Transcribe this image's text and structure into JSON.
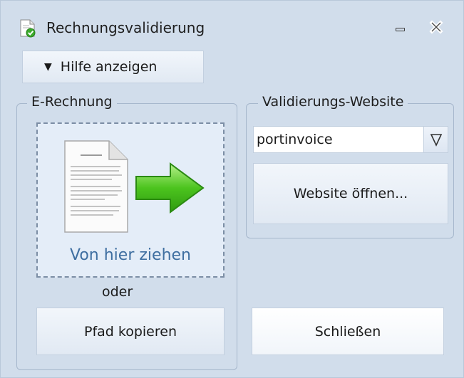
{
  "window": {
    "title": "Rechnungsvalidierung",
    "icons": {
      "app": "document-check-icon",
      "minimize": "minimize-icon",
      "close": "close-icon"
    }
  },
  "help": {
    "label": "Hilfe anzeigen",
    "icon": "triangle-down-icon"
  },
  "erechnung": {
    "legend": "E-Rechnung",
    "drop_label": "Von hier ziehen",
    "or_text": "oder",
    "copy_button": "Pfad kopieren",
    "icons": {
      "document": "document-icon",
      "arrow": "arrow-right-icon"
    }
  },
  "website": {
    "legend": "Validierungs-Website",
    "selected": "portinvoice",
    "open_button": "Website öffnen..."
  },
  "close_button": "Schließen",
  "colors": {
    "window_bg": "#d1ddeb",
    "dropzone_bg": "#e4edf8",
    "drop_label": "#3f6fa1",
    "arrow_green": "#4cc41e"
  }
}
